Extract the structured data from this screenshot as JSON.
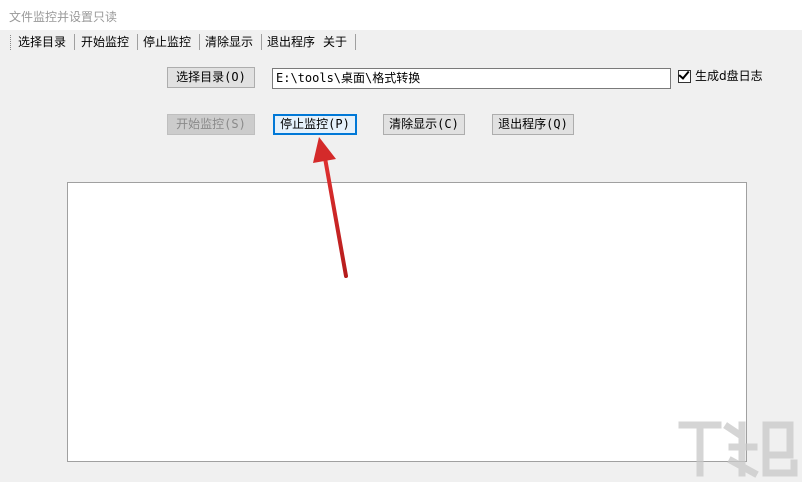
{
  "window": {
    "title": "文件监控并设置只读"
  },
  "menu": {
    "items": [
      "选择目录",
      "开始监控",
      "停止监控",
      "清除显示",
      "退出程序",
      "关于"
    ]
  },
  "controls": {
    "select_dir_button": "选择目录(O)",
    "path_value": "E:\\tools\\桌面\\格式转换",
    "log_checkbox_label": "生成d盘日志",
    "log_checkbox_checked": true,
    "start_button": "开始监控(S)",
    "stop_button": "停止监控(P)",
    "clear_button": "清除显示(C)",
    "exit_button": "退出程序(Q)"
  },
  "colors": {
    "annotation_arrow": "#d42a2a",
    "focus_border": "#0078d7"
  }
}
